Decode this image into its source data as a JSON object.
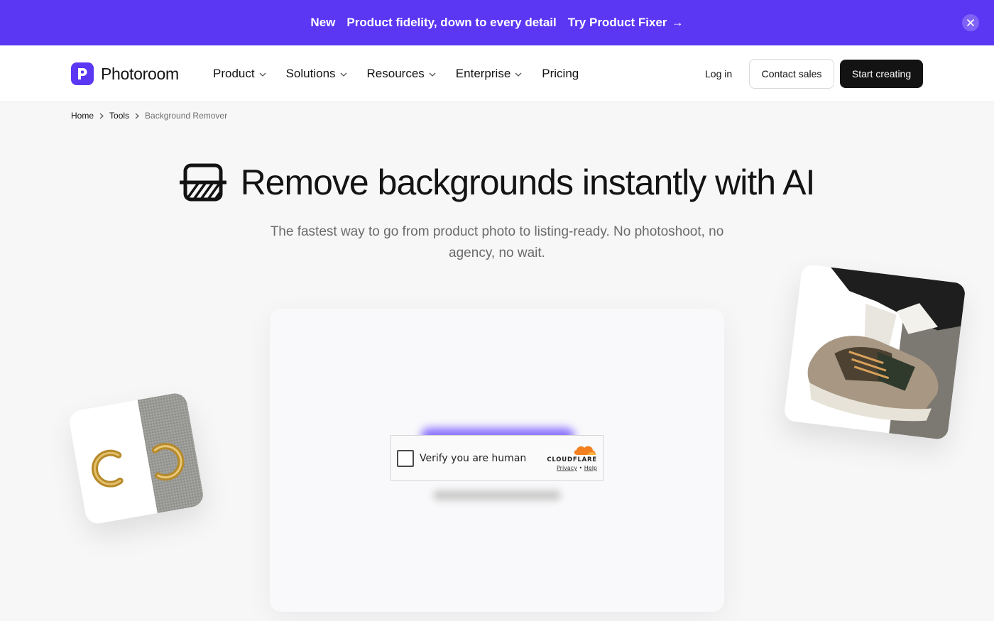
{
  "banner": {
    "badge": "New",
    "message": "Product fidelity, down to every detail",
    "cta": "Try Product Fixer",
    "cta_arrow": "→",
    "close_icon": "close-icon",
    "background_color": "#5b37f4"
  },
  "header": {
    "logo_text": "Photoroom",
    "logo_color": "#5b37f4",
    "nav": [
      {
        "label": "Product",
        "has_dropdown": true
      },
      {
        "label": "Solutions",
        "has_dropdown": true
      },
      {
        "label": "Resources",
        "has_dropdown": true
      },
      {
        "label": "Enterprise",
        "has_dropdown": true
      },
      {
        "label": "Pricing",
        "has_dropdown": false
      }
    ],
    "login": "Log in",
    "contact": "Contact sales",
    "start": "Start creating"
  },
  "breadcrumb": {
    "items": [
      "Home",
      "Tools",
      "Background Remover"
    ]
  },
  "hero": {
    "title": "Remove backgrounds instantly with AI",
    "subtitle": "The fastest way to go from product photo to listing-ready. No photoshoot, no agency, no wait.",
    "icon": "background-remover-icon"
  },
  "captcha": {
    "label": "Verify you are human",
    "brand": "CLOUDFLARE",
    "privacy": "Privacy",
    "separator": "•",
    "help": "Help",
    "brand_color": "#f38020"
  },
  "floating_images": {
    "left": "earrings-product-image",
    "right": "sneaker-product-image"
  }
}
